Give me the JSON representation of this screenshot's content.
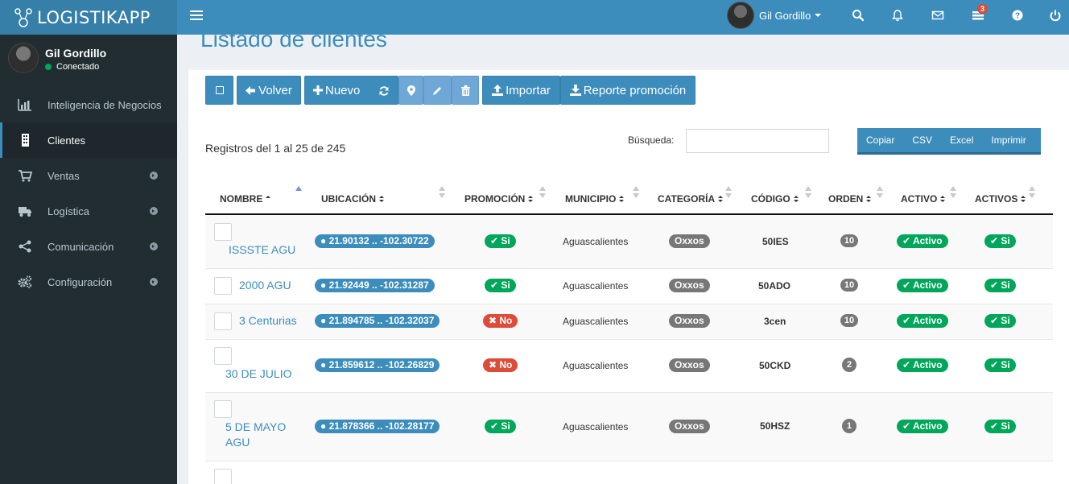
{
  "app": {
    "logo_text": "LOGISTIKAPP"
  },
  "header": {
    "user_name": "Gil Gordillo",
    "notifications_count": "3"
  },
  "sidebar": {
    "user_name": "Gil Gordillo",
    "status": "Conectado",
    "items": [
      {
        "label": "Inteligencia de Negocios",
        "icon": "bar-chart-icon"
      },
      {
        "label": "Clientes",
        "icon": "building-icon"
      },
      {
        "label": "Ventas",
        "icon": "cart-icon"
      },
      {
        "label": "Logística",
        "icon": "truck-icon"
      },
      {
        "label": "Comunicación",
        "icon": "share-icon"
      },
      {
        "label": "Configuración",
        "icon": "cogs-icon"
      }
    ]
  },
  "page": {
    "title": "Listado de clientes"
  },
  "toolbar": {
    "volver": "Volver",
    "nuevo": "Nuevo",
    "importar": "Importar",
    "reporte": "Reporte promoción"
  },
  "table_info": {
    "registros": "Registros del 1 al 25 de 245",
    "search_label": "Búsqueda:",
    "search_value": "",
    "export": [
      "Copiar",
      "CSV",
      "Excel",
      "Imprimir"
    ]
  },
  "table": {
    "headers": [
      "NOMBRE",
      "UBICACIÓN",
      "PROMOCIÓN",
      "MUNICIPIO",
      "CATEGORÍA",
      "CÓDIGO",
      "ORDEN",
      "ACTIVO",
      "ACTIVOS"
    ],
    "rows": [
      {
        "nombre": "ISSSTE AGU",
        "ubicacion": "21.90132 .. -102.30722",
        "promocion": "Si",
        "municipio": "Aguascalientes",
        "categoria": "Oxxos",
        "codigo": "50IES",
        "orden": "10",
        "activo": "Activo",
        "activos": "Si"
      },
      {
        "nombre": "2000 AGU",
        "ubicacion": "21.92449 .. -102.31287",
        "promocion": "Si",
        "municipio": "Aguascalientes",
        "categoria": "Oxxos",
        "codigo": "50ADO",
        "orden": "10",
        "activo": "Activo",
        "activos": "Si"
      },
      {
        "nombre": "3 Centurias",
        "ubicacion": "21.894785 .. -102.32037",
        "promocion": "No",
        "municipio": "Aguascalientes",
        "categoria": "Oxxos",
        "codigo": "3cen",
        "orden": "10",
        "activo": "Activo",
        "activos": "Si"
      },
      {
        "nombre": "30 DE JULIO",
        "ubicacion": "21.859612 .. -102.26829",
        "promocion": "No",
        "municipio": "Aguascalientes",
        "categoria": "Oxxos",
        "codigo": "50CKD",
        "orden": "2",
        "activo": "Activo",
        "activos": "Si"
      },
      {
        "nombre": "5 DE MAYO AGU",
        "ubicacion": "21.878366 .. -102.28177",
        "promocion": "Si",
        "municipio": "Aguascalientes",
        "categoria": "Oxxos",
        "codigo": "50HSZ",
        "orden": "1",
        "activo": "Activo",
        "activos": "Si"
      }
    ]
  },
  "colors": {
    "primary": "#3c8dbc",
    "sidebar": "#222d32",
    "success": "#00a65a",
    "danger": "#dd4b39"
  }
}
